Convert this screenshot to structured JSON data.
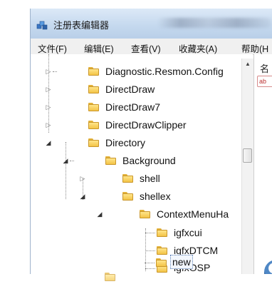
{
  "window": {
    "title": "注册表编辑器",
    "title_icon": "regedit-icon"
  },
  "menubar": {
    "items": [
      {
        "label": "文件(F)"
      },
      {
        "label": "编辑(E)"
      },
      {
        "label": "查看(V)"
      },
      {
        "label": "收藏夹(A)"
      },
      {
        "label": "帮助(H"
      }
    ]
  },
  "tree": {
    "nodes": [
      {
        "label": "Diagnostic.Resmon.Config",
        "expander": "collapsed"
      },
      {
        "label": "DirectDraw",
        "expander": "collapsed"
      },
      {
        "label": "DirectDraw7",
        "expander": "collapsed"
      },
      {
        "label": "DirectDrawClipper",
        "expander": "collapsed"
      },
      {
        "label": "Directory",
        "expander": "expanded"
      },
      {
        "label": "Background",
        "expander": "expanded"
      },
      {
        "label": "shell",
        "expander": "collapsed"
      },
      {
        "label": "shellex",
        "expander": "expanded"
      },
      {
        "label": "ContextMenuHa",
        "expander": "expanded"
      },
      {
        "label": "igfxcui",
        "expander": "none"
      },
      {
        "label": "igfxDTCM",
        "expander": "none"
      },
      {
        "label": "igfxOSP",
        "expander": "none"
      },
      {
        "label": "new",
        "expander": "none",
        "selected": true
      }
    ]
  },
  "right_pane": {
    "header": "名",
    "cell": "ab"
  },
  "colors": {
    "titlebar": "#c4d8ee",
    "folder": "#f3c447",
    "selection_border": "#5a7fb4"
  }
}
